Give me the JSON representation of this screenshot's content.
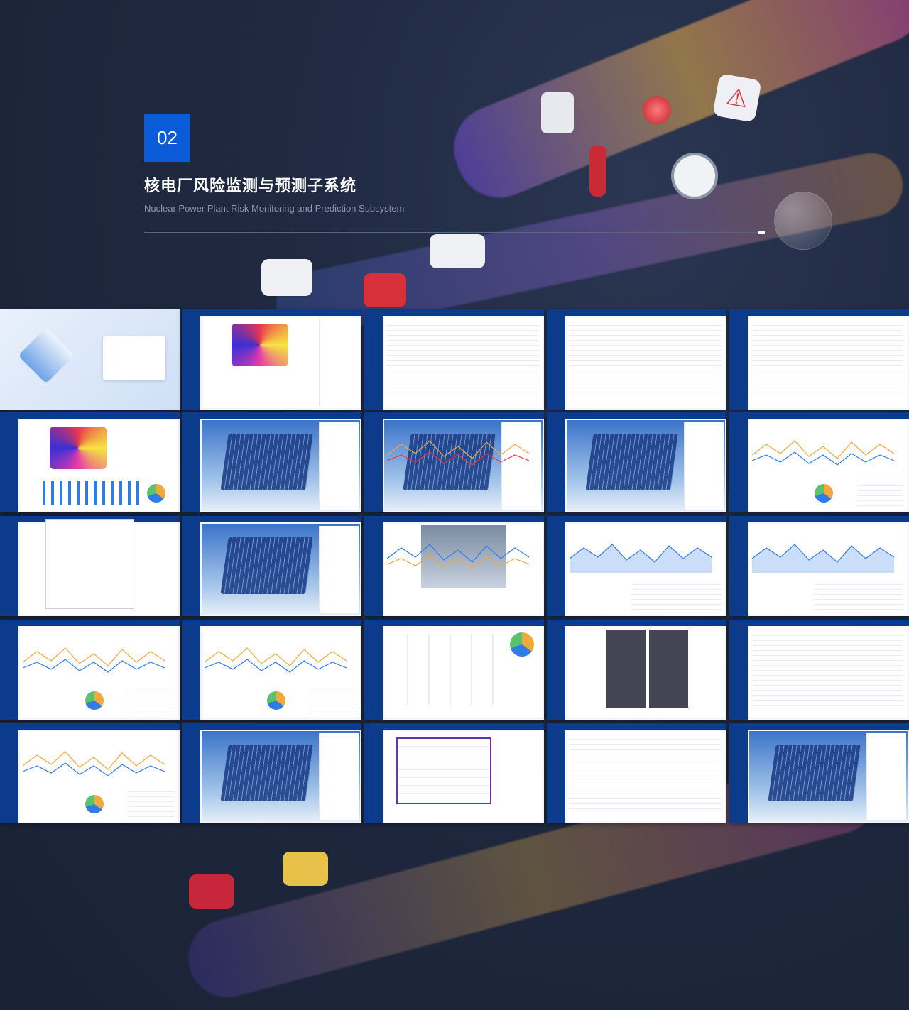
{
  "section": {
    "number": "02",
    "title": "核电厂风险监测与预测子系统",
    "subtitle": "Nuclear Power Plant Risk Monitoring and Prediction Subsystem"
  },
  "colors": {
    "background": "#1f2940",
    "accent_blue": "#0a5bd8",
    "ui_navy": "#0d3b8c"
  },
  "thumbnail_grid": {
    "rows": 5,
    "columns": 5,
    "screens": [
      {
        "kind": "login"
      },
      {
        "kind": "heatmap"
      },
      {
        "kind": "tree"
      },
      {
        "kind": "form"
      },
      {
        "kind": "table"
      },
      {
        "kind": "heatmap-dashboard"
      },
      {
        "kind": "3d-map"
      },
      {
        "kind": "3d-map-chart"
      },
      {
        "kind": "3d-map-list"
      },
      {
        "kind": "line-dashboard"
      },
      {
        "kind": "personnel-modal"
      },
      {
        "kind": "3d-map-list"
      },
      {
        "kind": "scene-dashboard"
      },
      {
        "kind": "area-dashboard"
      },
      {
        "kind": "area-dashboard"
      },
      {
        "kind": "line-dashboard"
      },
      {
        "kind": "line-dashboard"
      },
      {
        "kind": "sensor-cards"
      },
      {
        "kind": "camera-grid"
      },
      {
        "kind": "table"
      },
      {
        "kind": "line-dashboard"
      },
      {
        "kind": "3d-map-list"
      },
      {
        "kind": "flowchart"
      },
      {
        "kind": "tree-chart"
      },
      {
        "kind": "3d-map-list"
      }
    ]
  }
}
